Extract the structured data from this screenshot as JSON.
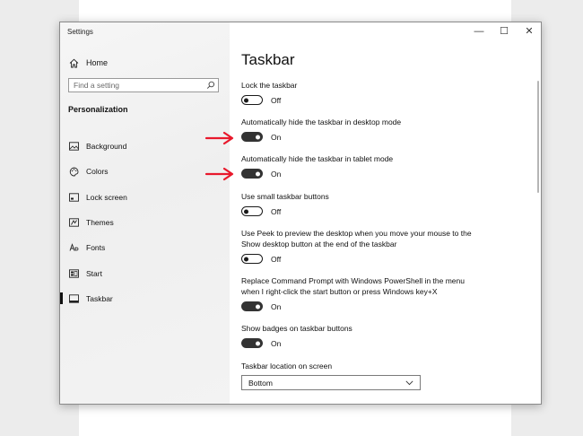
{
  "window": {
    "title": "Settings",
    "minimize_glyph": "—",
    "maximize_glyph": "☐",
    "close_glyph": "✕"
  },
  "sidebar": {
    "home_label": "Home",
    "search_placeholder": "Find a setting",
    "section_label": "Personalization",
    "items": [
      {
        "label": "Background",
        "icon": "background-icon"
      },
      {
        "label": "Colors",
        "icon": "palette-icon"
      },
      {
        "label": "Lock screen",
        "icon": "lock-screen-icon"
      },
      {
        "label": "Themes",
        "icon": "themes-icon"
      },
      {
        "label": "Fonts",
        "icon": "fonts-icon"
      },
      {
        "label": "Start",
        "icon": "start-icon"
      },
      {
        "label": "Taskbar",
        "icon": "taskbar-icon",
        "active": true
      }
    ]
  },
  "main": {
    "title": "Taskbar",
    "settings": [
      {
        "label": "Lock the taskbar",
        "state": "Off"
      },
      {
        "label": "Automatically hide the taskbar in desktop mode",
        "state": "On"
      },
      {
        "label": "Automatically hide the taskbar in tablet mode",
        "state": "On"
      },
      {
        "label": "Use small taskbar buttons",
        "state": "Off"
      },
      {
        "label": "Use Peek to preview the desktop when you move your mouse to the Show desktop button at the end of the taskbar",
        "state": "Off"
      },
      {
        "label": "Replace Command Prompt with Windows PowerShell in the menu when I right-click the start button or press Windows key+X",
        "state": "On"
      },
      {
        "label": "Show badges on taskbar buttons",
        "state": "On"
      }
    ],
    "location_label": "Taskbar location on screen",
    "location_value": "Bottom"
  },
  "colors": {
    "annotation_arrow": "#e8192c",
    "toggle_on": "#333333"
  }
}
